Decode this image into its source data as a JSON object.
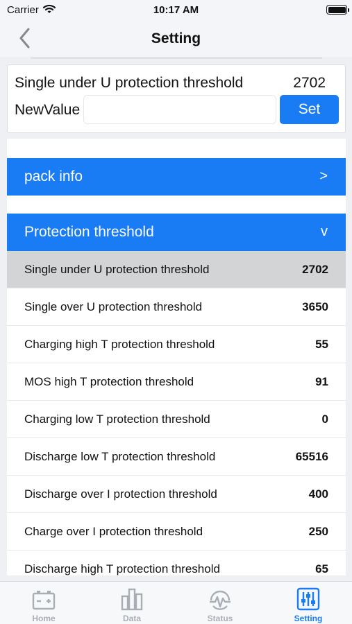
{
  "status_bar": {
    "carrier": "Carrier",
    "time": "10:17 AM"
  },
  "nav": {
    "title": "Setting"
  },
  "editor": {
    "param_name": "Single under U protection threshold",
    "param_value": "2702",
    "new_value_label": "NewValue",
    "new_value_input": "",
    "set_label": "Set"
  },
  "sections": {
    "pack_info": {
      "label": "pack info",
      "chevron": ">"
    },
    "protection": {
      "label": "Protection threshold",
      "chevron": "v"
    }
  },
  "rows": [
    {
      "name": "Single under U protection threshold",
      "value": "2702"
    },
    {
      "name": "Single over U protection threshold",
      "value": "3650"
    },
    {
      "name": "Charging high T protection threshold",
      "value": "55"
    },
    {
      "name": "MOS high T protection threshold",
      "value": "91"
    },
    {
      "name": "Charging low T protection threshold",
      "value": "0"
    },
    {
      "name": "Discharge low T protection threshold",
      "value": "65516"
    },
    {
      "name": "Discharge over I protection threshold",
      "value": "400"
    },
    {
      "name": "Charge over I protection threshold",
      "value": "250"
    },
    {
      "name": "Discharge high T protection threshold",
      "value": "65"
    }
  ],
  "tabs": [
    {
      "label": "Home",
      "icon": "battery-icon"
    },
    {
      "label": "Data",
      "icon": "bar-chart-icon"
    },
    {
      "label": "Status",
      "icon": "pulse-gauge-icon"
    },
    {
      "label": "Setting",
      "icon": "sliders-icon"
    }
  ],
  "colors": {
    "accent": "#1a7cf5",
    "selected_row": "#d3d4d6",
    "inactive_tab": "#a9adb4"
  }
}
